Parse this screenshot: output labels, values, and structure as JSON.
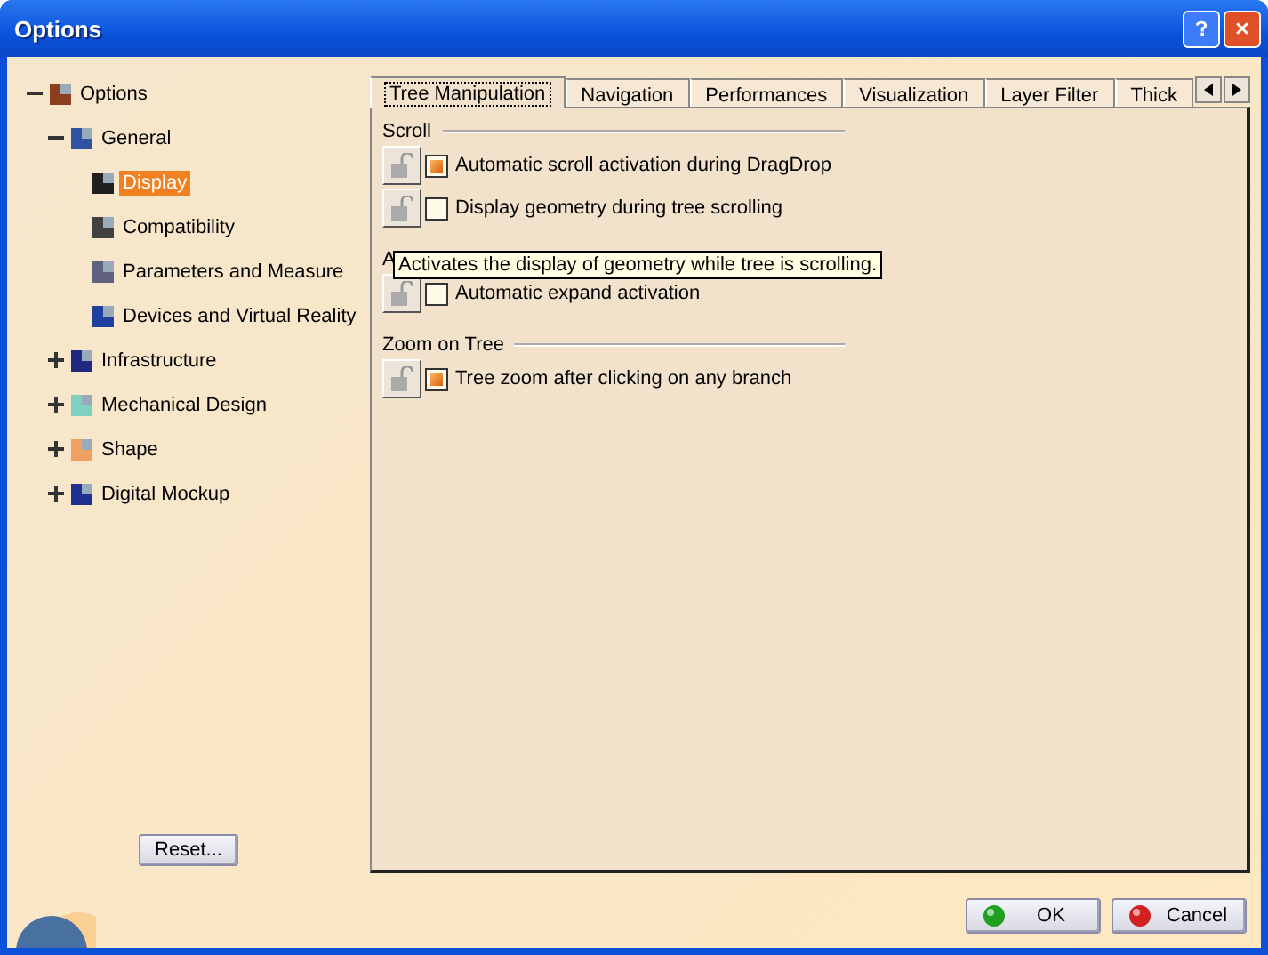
{
  "window": {
    "title": "Options"
  },
  "tree": [
    {
      "label": "Options",
      "expanded": true,
      "selected": false,
      "children": [
        {
          "label": "General",
          "expanded": true,
          "selected": false,
          "children": [
            {
              "label": "Display",
              "selected": true
            },
            {
              "label": "Compatibility",
              "selected": false
            },
            {
              "label": "Parameters and Measure",
              "selected": false
            },
            {
              "label": "Devices and Virtual Reality",
              "selected": false
            }
          ]
        },
        {
          "label": "Infrastructure",
          "expanded": false,
          "selected": false
        },
        {
          "label": "Mechanical Design",
          "expanded": false,
          "selected": false
        },
        {
          "label": "Shape",
          "expanded": false,
          "selected": false
        },
        {
          "label": "Digital Mockup",
          "expanded": false,
          "selected": false
        }
      ]
    }
  ],
  "reset_button": "Reset...",
  "tabs": [
    {
      "label": "Tree Manipulation",
      "selected": true
    },
    {
      "label": "Navigation",
      "selected": false
    },
    {
      "label": "Performances",
      "selected": false
    },
    {
      "label": "Visualization",
      "selected": false
    },
    {
      "label": "Layer Filter",
      "selected": false
    },
    {
      "label": "Thick",
      "selected": false
    }
  ],
  "sections": [
    {
      "title": "Scroll",
      "options": [
        {
          "label": "Automatic scroll activation during DragDrop",
          "checked": true
        },
        {
          "label": "Display geometry during tree scrolling",
          "checked": false
        }
      ]
    },
    {
      "title": "A",
      "options": [
        {
          "label": "Automatic expand activation",
          "checked": false
        }
      ]
    },
    {
      "title": "Zoom on Tree",
      "options": [
        {
          "label": "Tree zoom after clicking on any branch",
          "checked": true
        }
      ]
    }
  ],
  "tooltip": "Activates the display of geometry while tree is scrolling.",
  "buttons": [
    {
      "label": "OK",
      "kind": "ok"
    },
    {
      "label": "Cancel",
      "kind": "cancel"
    }
  ]
}
